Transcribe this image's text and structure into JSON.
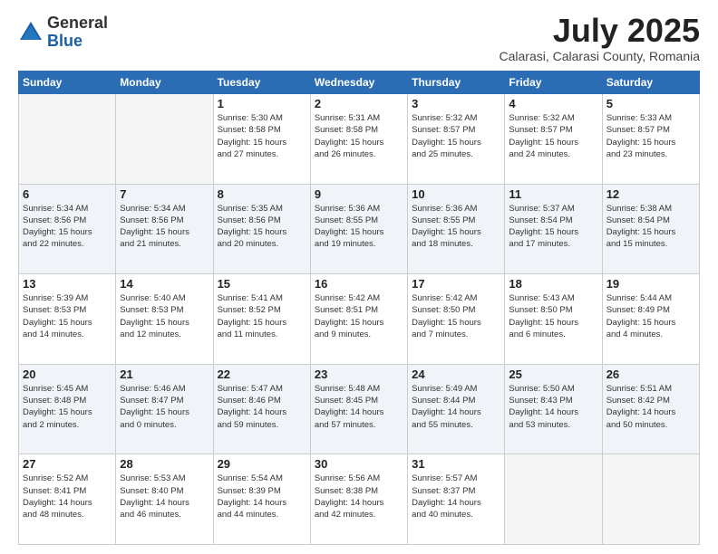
{
  "header": {
    "logo_general": "General",
    "logo_blue": "Blue",
    "month_title": "July 2025",
    "location": "Calarasi, Calarasi County, Romania"
  },
  "weekdays": [
    "Sunday",
    "Monday",
    "Tuesday",
    "Wednesday",
    "Thursday",
    "Friday",
    "Saturday"
  ],
  "weeks": [
    [
      {
        "day": "",
        "info": ""
      },
      {
        "day": "",
        "info": ""
      },
      {
        "day": "1",
        "info": "Sunrise: 5:30 AM\nSunset: 8:58 PM\nDaylight: 15 hours\nand 27 minutes."
      },
      {
        "day": "2",
        "info": "Sunrise: 5:31 AM\nSunset: 8:58 PM\nDaylight: 15 hours\nand 26 minutes."
      },
      {
        "day": "3",
        "info": "Sunrise: 5:32 AM\nSunset: 8:57 PM\nDaylight: 15 hours\nand 25 minutes."
      },
      {
        "day": "4",
        "info": "Sunrise: 5:32 AM\nSunset: 8:57 PM\nDaylight: 15 hours\nand 24 minutes."
      },
      {
        "day": "5",
        "info": "Sunrise: 5:33 AM\nSunset: 8:57 PM\nDaylight: 15 hours\nand 23 minutes."
      }
    ],
    [
      {
        "day": "6",
        "info": "Sunrise: 5:34 AM\nSunset: 8:56 PM\nDaylight: 15 hours\nand 22 minutes."
      },
      {
        "day": "7",
        "info": "Sunrise: 5:34 AM\nSunset: 8:56 PM\nDaylight: 15 hours\nand 21 minutes."
      },
      {
        "day": "8",
        "info": "Sunrise: 5:35 AM\nSunset: 8:56 PM\nDaylight: 15 hours\nand 20 minutes."
      },
      {
        "day": "9",
        "info": "Sunrise: 5:36 AM\nSunset: 8:55 PM\nDaylight: 15 hours\nand 19 minutes."
      },
      {
        "day": "10",
        "info": "Sunrise: 5:36 AM\nSunset: 8:55 PM\nDaylight: 15 hours\nand 18 minutes."
      },
      {
        "day": "11",
        "info": "Sunrise: 5:37 AM\nSunset: 8:54 PM\nDaylight: 15 hours\nand 17 minutes."
      },
      {
        "day": "12",
        "info": "Sunrise: 5:38 AM\nSunset: 8:54 PM\nDaylight: 15 hours\nand 15 minutes."
      }
    ],
    [
      {
        "day": "13",
        "info": "Sunrise: 5:39 AM\nSunset: 8:53 PM\nDaylight: 15 hours\nand 14 minutes."
      },
      {
        "day": "14",
        "info": "Sunrise: 5:40 AM\nSunset: 8:53 PM\nDaylight: 15 hours\nand 12 minutes."
      },
      {
        "day": "15",
        "info": "Sunrise: 5:41 AM\nSunset: 8:52 PM\nDaylight: 15 hours\nand 11 minutes."
      },
      {
        "day": "16",
        "info": "Sunrise: 5:42 AM\nSunset: 8:51 PM\nDaylight: 15 hours\nand 9 minutes."
      },
      {
        "day": "17",
        "info": "Sunrise: 5:42 AM\nSunset: 8:50 PM\nDaylight: 15 hours\nand 7 minutes."
      },
      {
        "day": "18",
        "info": "Sunrise: 5:43 AM\nSunset: 8:50 PM\nDaylight: 15 hours\nand 6 minutes."
      },
      {
        "day": "19",
        "info": "Sunrise: 5:44 AM\nSunset: 8:49 PM\nDaylight: 15 hours\nand 4 minutes."
      }
    ],
    [
      {
        "day": "20",
        "info": "Sunrise: 5:45 AM\nSunset: 8:48 PM\nDaylight: 15 hours\nand 2 minutes."
      },
      {
        "day": "21",
        "info": "Sunrise: 5:46 AM\nSunset: 8:47 PM\nDaylight: 15 hours\nand 0 minutes."
      },
      {
        "day": "22",
        "info": "Sunrise: 5:47 AM\nSunset: 8:46 PM\nDaylight: 14 hours\nand 59 minutes."
      },
      {
        "day": "23",
        "info": "Sunrise: 5:48 AM\nSunset: 8:45 PM\nDaylight: 14 hours\nand 57 minutes."
      },
      {
        "day": "24",
        "info": "Sunrise: 5:49 AM\nSunset: 8:44 PM\nDaylight: 14 hours\nand 55 minutes."
      },
      {
        "day": "25",
        "info": "Sunrise: 5:50 AM\nSunset: 8:43 PM\nDaylight: 14 hours\nand 53 minutes."
      },
      {
        "day": "26",
        "info": "Sunrise: 5:51 AM\nSunset: 8:42 PM\nDaylight: 14 hours\nand 50 minutes."
      }
    ],
    [
      {
        "day": "27",
        "info": "Sunrise: 5:52 AM\nSunset: 8:41 PM\nDaylight: 14 hours\nand 48 minutes."
      },
      {
        "day": "28",
        "info": "Sunrise: 5:53 AM\nSunset: 8:40 PM\nDaylight: 14 hours\nand 46 minutes."
      },
      {
        "day": "29",
        "info": "Sunrise: 5:54 AM\nSunset: 8:39 PM\nDaylight: 14 hours\nand 44 minutes."
      },
      {
        "day": "30",
        "info": "Sunrise: 5:56 AM\nSunset: 8:38 PM\nDaylight: 14 hours\nand 42 minutes."
      },
      {
        "day": "31",
        "info": "Sunrise: 5:57 AM\nSunset: 8:37 PM\nDaylight: 14 hours\nand 40 minutes."
      },
      {
        "day": "",
        "info": ""
      },
      {
        "day": "",
        "info": ""
      }
    ]
  ]
}
